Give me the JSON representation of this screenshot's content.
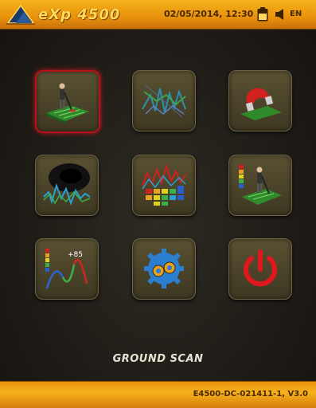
{
  "header": {
    "logo_text": "eXp 4500",
    "datetime": "02/05/2014, 12:30",
    "language": "EN"
  },
  "menu": {
    "items": [
      {
        "id": "ground-scan",
        "icon": "ground-scan-icon",
        "selected": true
      },
      {
        "id": "automatic-scan",
        "icon": "automatic-scan-icon",
        "selected": false
      },
      {
        "id": "magnetometer",
        "icon": "magnet-icon",
        "selected": false
      },
      {
        "id": "cavity-detection",
        "icon": "cavity-icon",
        "selected": false
      },
      {
        "id": "discrimination",
        "icon": "discrimination-icon",
        "selected": false
      },
      {
        "id": "live-stream",
        "icon": "live-stream-icon",
        "selected": false
      },
      {
        "id": "pinpointer",
        "icon": "pinpointer-icon",
        "selected": false,
        "value_label": "+85"
      },
      {
        "id": "settings",
        "icon": "gears-icon",
        "selected": false
      },
      {
        "id": "power-off",
        "icon": "power-icon",
        "selected": false
      }
    ]
  },
  "status": {
    "mode_label": "GROUND SCAN"
  },
  "footer": {
    "version": "E4500-DC-021411-1, V3.0"
  },
  "colors": {
    "bar_orange": "#f6b21c",
    "selection_red": "#d1161d",
    "tile_olive": "#5a5132"
  }
}
